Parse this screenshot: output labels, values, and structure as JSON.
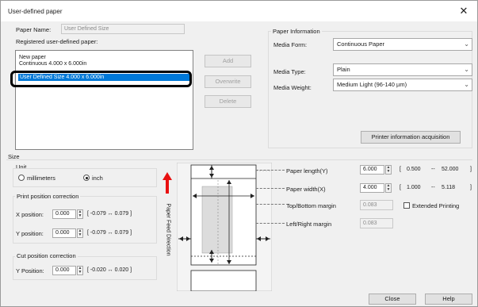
{
  "window": {
    "title": "User-defined paper",
    "close_glyph": "✕"
  },
  "paper_name": {
    "label": "Paper Name:",
    "value": "User Defined Size"
  },
  "registered": {
    "label": "Registered user-defined paper:",
    "items": [
      "New paper",
      "Continuous 4.000 x 6.000in",
      "",
      "User Defined Size 4.000 x 6.000in"
    ]
  },
  "buttons": {
    "add": "Add",
    "overwrite": "Overwrite",
    "delete": "Delete",
    "printer_info": "Printer information acquisition",
    "close": "Close",
    "help": "Help"
  },
  "paper_info": {
    "label": "Paper Information",
    "media_form_label": "Media Form:",
    "media_form_value": "Continuous Paper",
    "media_type_label": "Media Type:",
    "media_type_value": "Plain",
    "media_weight_label": "Media Weight:",
    "media_weight_value": "Medium Light (96-140 µm)"
  },
  "size": {
    "label": "Size",
    "unit_label": "Unit",
    "unit_mm": "millimeters",
    "unit_inch": "inch",
    "selected_unit": "inch",
    "print_pos_label": "Print position correction",
    "x_pos_label": "X position:",
    "x_pos_value": "0.000",
    "x_pos_range": "[ -0.079  ↔  0.079  ]",
    "y_pos_label": "Y position:",
    "y_pos_value": "0.000",
    "y_pos_range": "[ -0.079  ↔  0.079  ]",
    "cut_label": "Cut position correction",
    "cut_y_label": "Y Position:",
    "cut_y_value": "0.000",
    "cut_y_range": "[ -0.020  ↔  0.020  ]"
  },
  "feed_direction": "Paper Feed Direction",
  "dimensions": {
    "length_label": "Paper length(Y)",
    "length_value": "6.000",
    "length_min": "0.500",
    "length_max": "52.000",
    "width_label": "Paper width(X)",
    "width_value": "4.000",
    "width_min": "1.000",
    "width_max": "5.118",
    "tb_label": "Top/Bottom margin",
    "tb_value": "0.083",
    "lr_label": "Left/Right margin",
    "lr_value": "0.083",
    "extended_label": "Extended Printing",
    "range_open": "[",
    "range_sep": "--",
    "range_close": "]"
  },
  "colors": {
    "selection": "#0078d7",
    "highlight_frame": "#000000",
    "arrow": "#e81010"
  }
}
